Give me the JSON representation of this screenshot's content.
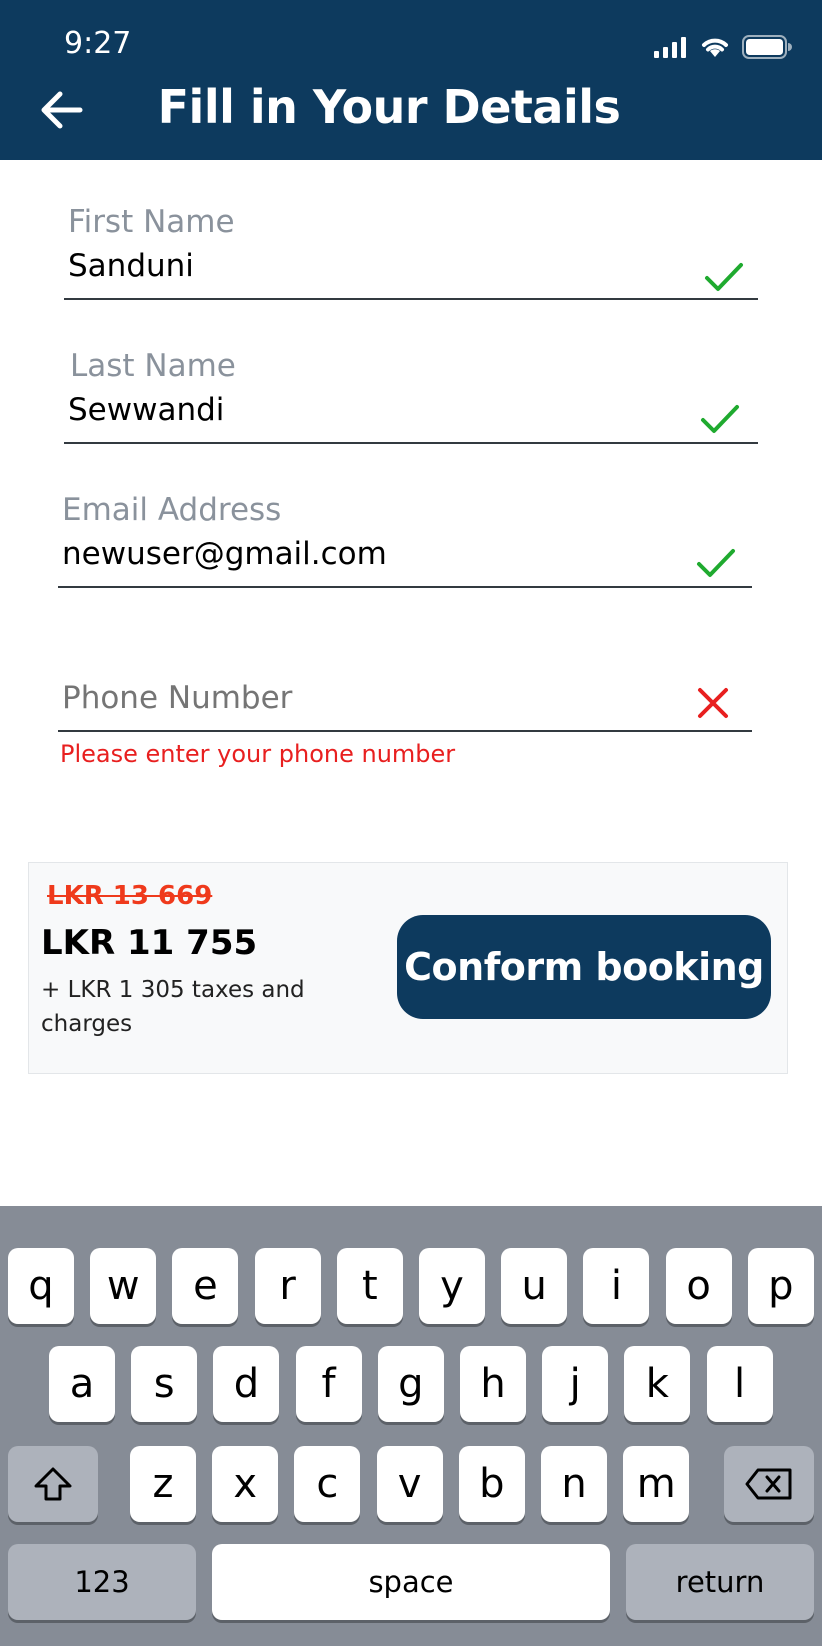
{
  "status": {
    "time": "9:27"
  },
  "header": {
    "title": "Fill in Your Details"
  },
  "form": {
    "first_name": {
      "label": "First Name",
      "value": "Sanduni",
      "state": "valid"
    },
    "last_name": {
      "label": "Last Name",
      "value": "Sewwandi",
      "state": "valid"
    },
    "email": {
      "label": "Email Address",
      "value": "newuser@gmail.com",
      "state": "valid"
    },
    "phone": {
      "placeholder": "Phone Number",
      "value": "",
      "state": "invalid",
      "error": "Please enter your phone number"
    }
  },
  "booking": {
    "old_price": "LKR 13 669",
    "price": "LKR 11 755",
    "taxes": "+ LKR 1 305 taxes and charges",
    "confirm_label": "Conform booking"
  },
  "keyboard": {
    "row1": [
      "q",
      "w",
      "e",
      "r",
      "t",
      "y",
      "u",
      "i",
      "o",
      "p"
    ],
    "row2": [
      "a",
      "s",
      "d",
      "f",
      "g",
      "h",
      "j",
      "k",
      "l"
    ],
    "row3": [
      "z",
      "x",
      "c",
      "v",
      "b",
      "n",
      "m"
    ],
    "numbers_label": "123",
    "space_label": "space",
    "return_label": "return"
  },
  "colors": {
    "header": "#0d3a5e",
    "valid": "#1faa2f",
    "invalid": "#e81f1f",
    "old_price": "#ef3a1c"
  },
  "icons": {
    "back": "arrow-left-icon",
    "valid": "checkmark-icon",
    "invalid": "x-icon",
    "shift": "shift-icon",
    "delete": "backspace-icon"
  }
}
